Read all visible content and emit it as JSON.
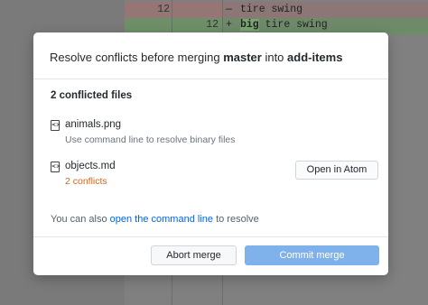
{
  "background": {
    "diff": {
      "deleted": {
        "old_line": "12",
        "marker": "—",
        "text": "tire swing"
      },
      "added": {
        "new_line": "12",
        "marker": "+",
        "highlight": "big",
        "text": " tire swing"
      }
    }
  },
  "dialog": {
    "title_prefix": "Resolve conflicts before merging ",
    "source_branch": "master",
    "title_mid": " into ",
    "target_branch": "add-items",
    "section_title": "2 conflicted files",
    "files": [
      {
        "name": "animals.png",
        "status": "Use command line to resolve binary files",
        "icon": "file-code-icon"
      },
      {
        "name": "objects.md",
        "status": "2 conflicts",
        "icon": "file-code-icon"
      }
    ],
    "open_in_atom_label": "Open in Atom",
    "hint_prefix": "You can also ",
    "hint_link": "open the command line",
    "hint_suffix": " to resolve",
    "abort_label": "Abort merge",
    "commit_label": "Commit merge"
  },
  "colors": {
    "conflict_text": "#e36209",
    "link": "#0366d6",
    "commit_button": "#7fb2ea"
  }
}
